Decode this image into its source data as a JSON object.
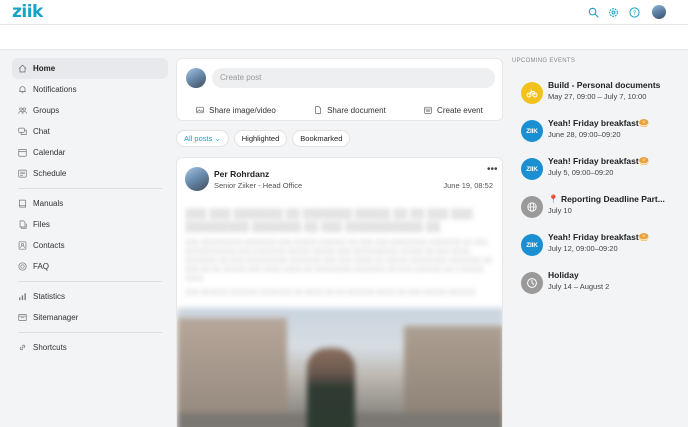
{
  "app": {
    "logo": "ziik"
  },
  "topbar": {
    "icons": [
      "search-icon",
      "gear-icon",
      "help-icon"
    ],
    "accent": "#1aa3c7"
  },
  "sidebar": {
    "groups": [
      [
        {
          "label": "Home",
          "icon": "home-icon",
          "active": true
        },
        {
          "label": "Notifications",
          "icon": "bell-icon"
        },
        {
          "label": "Groups",
          "icon": "groups-icon"
        },
        {
          "label": "Chat",
          "icon": "chat-icon"
        },
        {
          "label": "Calendar",
          "icon": "calendar-icon"
        },
        {
          "label": "Schedule",
          "icon": "schedule-icon"
        }
      ],
      [
        {
          "label": "Manuals",
          "icon": "manual-icon"
        },
        {
          "label": "Files",
          "icon": "files-icon"
        },
        {
          "label": "Contacts",
          "icon": "contacts-icon"
        },
        {
          "label": "FAQ",
          "icon": "faq-icon"
        }
      ],
      [
        {
          "label": "Statistics",
          "icon": "statistics-icon"
        },
        {
          "label": "Sitemanager",
          "icon": "sitemanager-icon"
        }
      ],
      [
        {
          "label": "Shortcuts",
          "icon": "link-icon"
        }
      ]
    ]
  },
  "composer": {
    "placeholder": "Create post",
    "actions": [
      {
        "label": "Share image/video",
        "icon": "image-icon"
      },
      {
        "label": "Share document",
        "icon": "document-icon"
      },
      {
        "label": "Create event",
        "icon": "event-icon"
      }
    ]
  },
  "filters": [
    {
      "label": "All posts",
      "active": true,
      "has_chevron": true
    },
    {
      "label": "Highlighted",
      "active": false
    },
    {
      "label": "Bookmarked",
      "active": false
    }
  ],
  "post": {
    "author": "Per Rohrdanz",
    "role": "Senior Ziiker - Head Office",
    "date": "June 19, 08:52",
    "more": "•••"
  },
  "events": {
    "heading": "UPCOMING EVENTS",
    "items": [
      {
        "title": "Build - Personal documents",
        "time": "May 27, 09:00 – July 7, 10:00",
        "badge": "bike-icon",
        "color": "#f2c11b"
      },
      {
        "title": "Yeah! Friday breakfast🥯",
        "time": "June 28, 09:00–09:20",
        "badge": "ziik-icon",
        "badge_text": "ZIIK",
        "color": "#1a8fd1"
      },
      {
        "title": "Yeah! Friday breakfast🥯",
        "time": "July 5, 09:00–09:20",
        "badge": "ziik-icon",
        "badge_text": "ZIIK",
        "color": "#1a8fd1"
      },
      {
        "title": "📍 Reporting Deadline Part...",
        "time": "July 10",
        "badge": "globe-icon",
        "color": "#9a9a9a"
      },
      {
        "title": "Yeah! Friday breakfast🥯",
        "time": "July 12, 09:00–09:20",
        "badge": "ziik-icon",
        "badge_text": "ZIIK",
        "color": "#1a8fd1"
      },
      {
        "title": "Holiday",
        "time": "July 14 – August 2",
        "badge": "clock-icon",
        "color": "#9a9a9a"
      }
    ]
  }
}
